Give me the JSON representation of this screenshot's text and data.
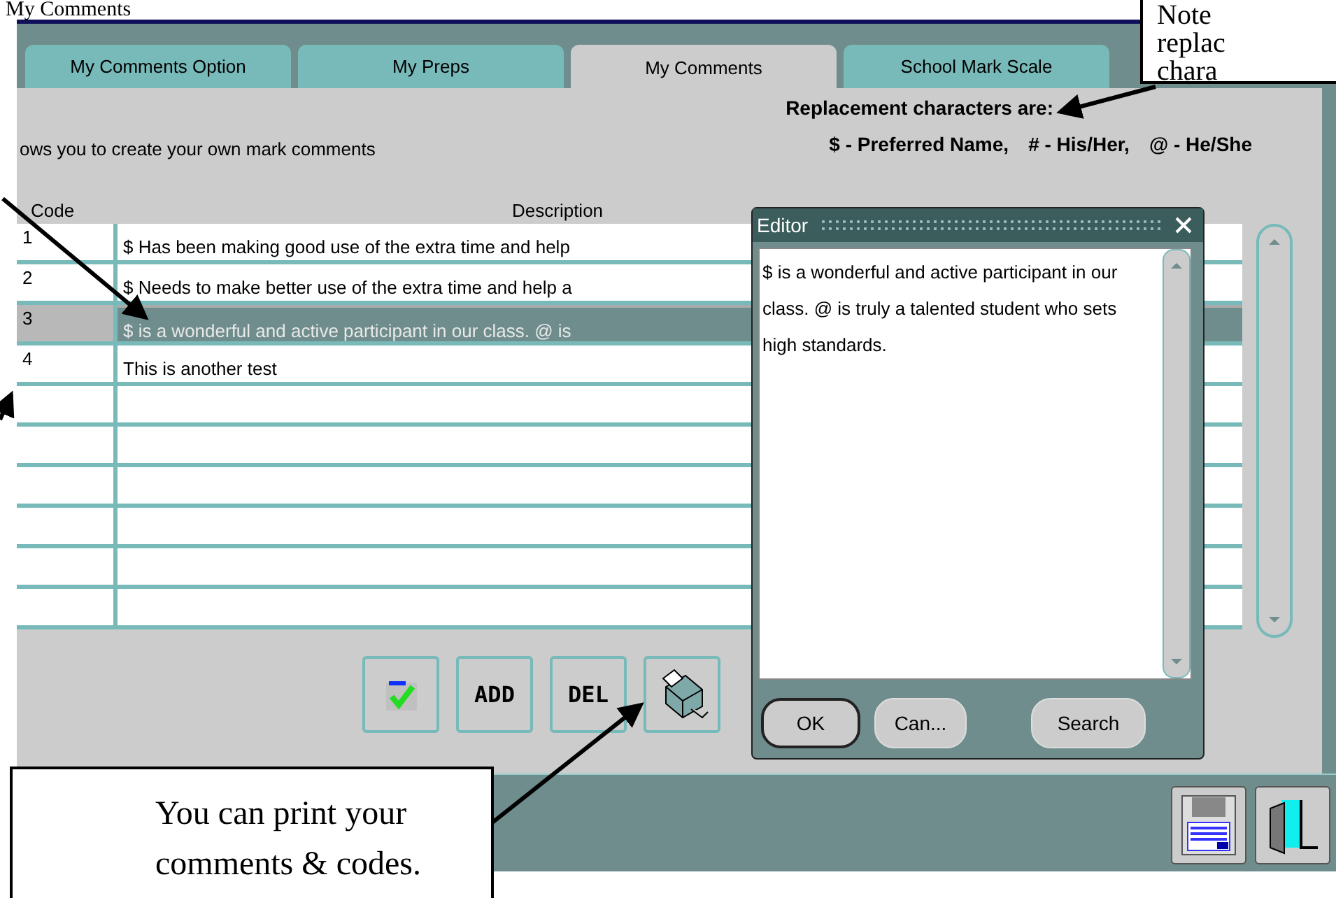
{
  "page_title": "My Comments",
  "tabs": [
    {
      "label": "My Comments Option",
      "selected": false
    },
    {
      "label": "My Preps",
      "selected": false
    },
    {
      "label": "My Comments",
      "selected": true
    },
    {
      "label": "School Mark Scale",
      "selected": false
    }
  ],
  "intro": "ows you to create your own mark comments",
  "replacement": {
    "heading": "Replacement characters are:",
    "items": [
      "$ - Preferred Name,",
      "# - His/Her,",
      "@ - He/She"
    ]
  },
  "table": {
    "columns": [
      "Code",
      "Description"
    ],
    "rows": [
      {
        "code": "1",
        "description": "$ Has been making good use of the extra time and help",
        "selected": false
      },
      {
        "code": "2",
        "description": "$ Needs to make better use of the extra time and help a",
        "selected": false
      },
      {
        "code": "3",
        "description": "$ is a wonderful and active participant in our class. @ is",
        "selected": true
      },
      {
        "code": "4",
        "description": "This is another test",
        "selected": false
      },
      {
        "selected": false
      },
      {
        "selected": false
      },
      {
        "selected": false
      },
      {
        "selected": false
      },
      {
        "selected": false
      },
      {
        "selected": false
      }
    ]
  },
  "toolbar": [
    {
      "kind": "spellcheck"
    },
    {
      "kind": "text",
      "label": "ADD"
    },
    {
      "kind": "text",
      "label": "DEL"
    },
    {
      "kind": "print"
    }
  ],
  "editor": {
    "title": "Editor",
    "text": "$ is a wonderful and active participant in our class. @ is truly a talented student who sets high standards.",
    "buttons": [
      "OK",
      "Can...",
      "Search"
    ]
  },
  "callouts": [
    {
      "kind": "top",
      "lines": [
        "Note",
        "replac",
        "chara"
      ]
    },
    {
      "kind": "bottom",
      "text": "You can print your comments & codes."
    }
  ]
}
